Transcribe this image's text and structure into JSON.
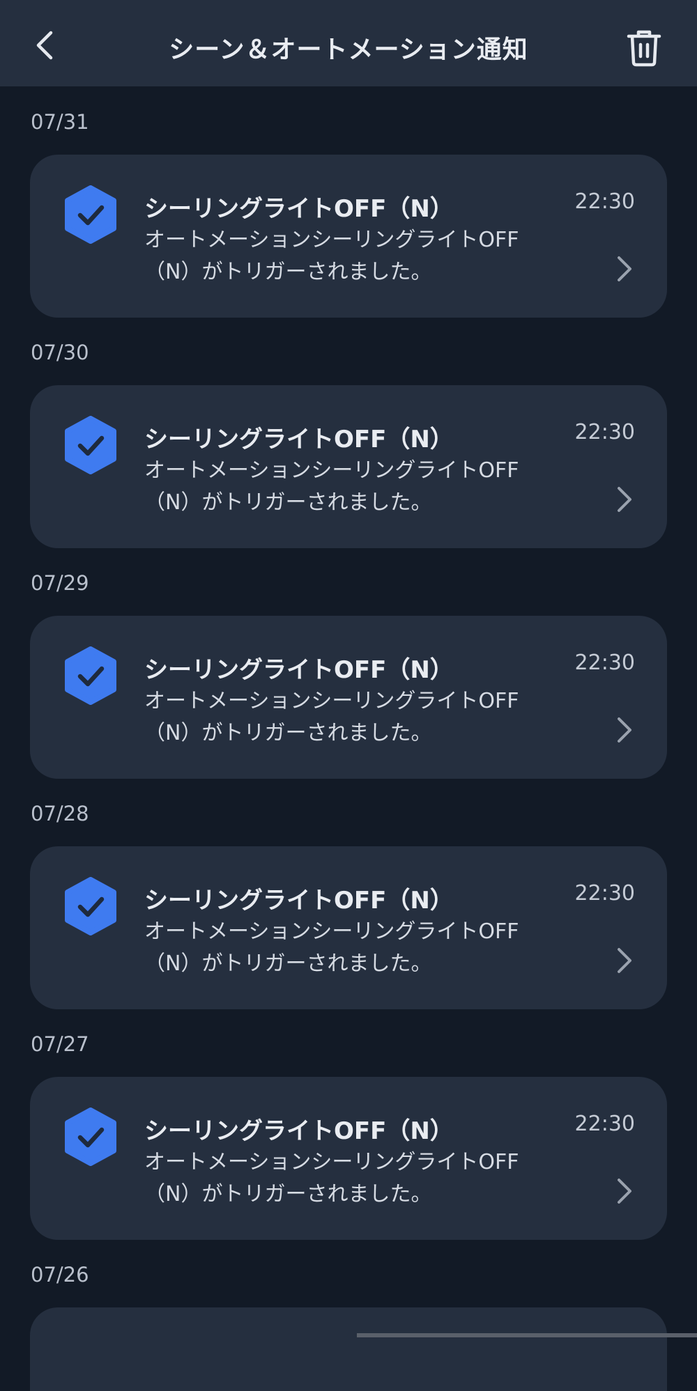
{
  "header": {
    "title": "シーン＆オートメーション通知",
    "back_icon": "chevron-left-icon",
    "trash_icon": "trash-icon"
  },
  "colors": {
    "background": "#121a26",
    "surface": "#252f3f",
    "accent": "#3f7bf0"
  },
  "groups": [
    {
      "date": "07/31",
      "card": {
        "icon": "check-hexagon-icon",
        "title": "シーリングライトOFF（N）",
        "time": "22:30",
        "message_line1": "オートメーションシーリングライトOFF",
        "message_line2": "（N）がトリガーされました。"
      }
    },
    {
      "date": "07/30",
      "card": {
        "icon": "check-hexagon-icon",
        "title": "シーリングライトOFF（N）",
        "time": "22:30",
        "message_line1": "オートメーションシーリングライトOFF",
        "message_line2": "（N）がトリガーされました。"
      }
    },
    {
      "date": "07/29",
      "card": {
        "icon": "check-hexagon-icon",
        "title": "シーリングライトOFF（N）",
        "time": "22:30",
        "message_line1": "オートメーションシーリングライトOFF",
        "message_line2": "（N）がトリガーされました。"
      }
    },
    {
      "date": "07/28",
      "card": {
        "icon": "check-hexagon-icon",
        "title": "シーリングライトOFF（N）",
        "time": "22:30",
        "message_line1": "オートメーションシーリングライトOFF",
        "message_line2": "（N）がトリガーされました。"
      }
    },
    {
      "date": "07/27",
      "card": {
        "icon": "check-hexagon-icon",
        "title": "シーリングライトOFF（N）",
        "time": "22:30",
        "message_line1": "オートメーションシーリングライトOFF",
        "message_line2": "（N）がトリガーされました。"
      }
    },
    {
      "date": "07/26"
    }
  ]
}
